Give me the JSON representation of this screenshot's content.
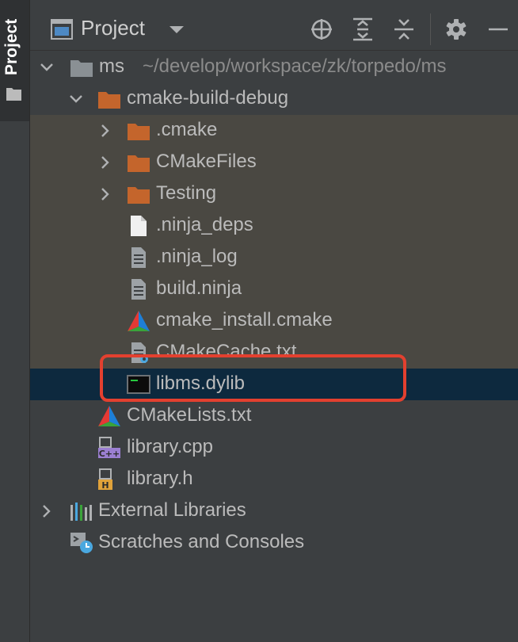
{
  "colors": {
    "background": "#3c3f41",
    "selection": "#0d293e",
    "dimmed_row": "#4a4842",
    "folder_orange": "#c4652c",
    "folder_gray": "#8a9094",
    "highlight_border": "#e3402f",
    "text": "#bbbbbb",
    "hint_text": "#8b8b8b"
  },
  "sidebar": {
    "label": "Project",
    "icon": "folder-icon"
  },
  "header": {
    "title": "Project",
    "actions": [
      {
        "name": "locate-file-button",
        "icon": "crosshair-icon"
      },
      {
        "name": "expand-all-button",
        "icon": "expand-all-icon"
      },
      {
        "name": "collapse-all-button",
        "icon": "collapse-all-icon"
      },
      {
        "name": "settings-button",
        "icon": "gear-icon"
      },
      {
        "name": "hide-button",
        "icon": "minimize-icon"
      }
    ]
  },
  "tree": {
    "root": {
      "label": "ms",
      "path": "~/develop/workspace/zk/torpedo/ms",
      "expanded": true
    },
    "items": [
      {
        "label": "cmake-build-debug",
        "icon": "folder-icon",
        "expanded": true
      },
      {
        "label": ".cmake",
        "icon": "folder-icon",
        "expanded": false
      },
      {
        "label": "CMakeFiles",
        "icon": "folder-icon",
        "expanded": false
      },
      {
        "label": "Testing",
        "icon": "folder-icon",
        "expanded": false
      },
      {
        "label": ".ninja_deps",
        "icon": "file-icon"
      },
      {
        "label": ".ninja_log",
        "icon": "text-file-icon"
      },
      {
        "label": "build.ninja",
        "icon": "text-file-icon"
      },
      {
        "label": "cmake_install.cmake",
        "icon": "cmake-icon"
      },
      {
        "label": "CMakeCache.txt",
        "icon": "config-file-icon"
      },
      {
        "label": "libms.dylib",
        "icon": "terminal-binary-icon",
        "selected": true
      },
      {
        "label": "CMakeLists.txt",
        "icon": "cmake-icon"
      },
      {
        "label": "library.cpp",
        "icon": "cpp-file-icon",
        "badge": "C++"
      },
      {
        "label": "library.h",
        "icon": "header-file-icon",
        "badge": "H"
      },
      {
        "label": "External Libraries",
        "icon": "libraries-icon",
        "expanded": false
      },
      {
        "label": "Scratches and Consoles",
        "icon": "scratches-icon"
      }
    ]
  }
}
